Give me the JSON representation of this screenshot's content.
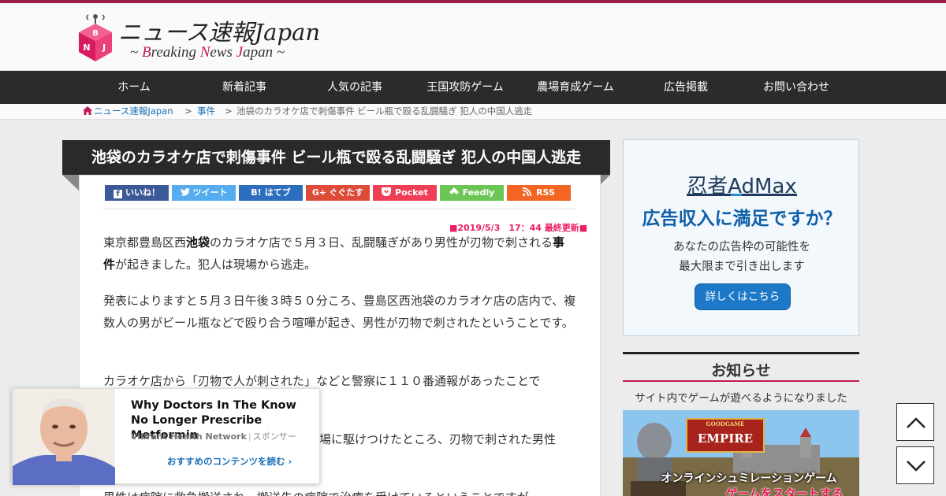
{
  "site": {
    "title": "ニュース速報Japan",
    "subtitle_parts": [
      "~ ",
      "B",
      "reaking ",
      "N",
      "ews ",
      "J",
      "apan ~"
    ],
    "logo_letters": [
      "B",
      "N",
      "J"
    ]
  },
  "nav": {
    "items": [
      "ホーム",
      "新着記事",
      "人気の記事",
      "王国攻防ゲーム",
      "農場育成ゲーム",
      "広告掲載",
      "お問い合わせ"
    ]
  },
  "breadcrumb": {
    "home": "ニュース速報Japan",
    "separator": ">",
    "category": "事件",
    "current": "池袋のカラオケ店で刺傷事件 ビール瓶で殴る乱闘騒ぎ 犯人の中国人逃走"
  },
  "article": {
    "title": "池袋のカラオケ店で刺傷事件 ビール瓶で殴る乱闘騒ぎ 犯人の中国人逃走",
    "updated": "■2019/5/3　17：44 最終更新■",
    "share": [
      {
        "label": "いいね！",
        "color": "#3b5998"
      },
      {
        "label": "ツイート",
        "color": "#55acee"
      },
      {
        "label": "はてブ",
        "color": "#2c6ebd"
      },
      {
        "label": "ぐぐたす",
        "color": "#dd4b39"
      },
      {
        "label": "Pocket",
        "color": "#ef3f56"
      },
      {
        "label": "Feedly",
        "color": "#6cc655"
      },
      {
        "label": "RSS",
        "color": "#f26522"
      }
    ],
    "p1": {
      "a": "東京都豊島区西",
      "b": "池袋",
      "c": "のカラオケ店で５月３日、乱闘騒ぎがあり男性が刃物で刺される",
      "d": "事件",
      "e": "が起きました。犯人は現場から逃走。"
    },
    "p2": "発表によりますと５月３日午後３時５０分ころ、豊島区西池袋のカラオケ店の店内で、複数人の男がビール瓶などで殴り合う喧嘩が起き、男性が刃物で刺されたということです。",
    "p3": "カラオケ店から「刃物で人が刺された」などと警察に１１０番通報があったことで",
    "p4": "場に駆けつけたところ、刃物で刺された男性",
    "p5": "男性は病院に救急搬送され、搬送先の病院で治療を受けているということですが"
  },
  "ad": {
    "brand": "忍者AdMax",
    "headline": "広告収入に満足ですか？",
    "line1": "あなたの広告枠の可能性を",
    "line2": "最大限まで引き出します",
    "button": "詳しくはこちら"
  },
  "notice": {
    "title": "お知らせ",
    "text": "サイト内でゲームが遊べるようになりました"
  },
  "game_banner": {
    "label": "オンラインシュミレーションゲーム",
    "cta": "ゲームをスタートする",
    "logo_small": "GOODGAME",
    "logo": "EMPIRE"
  },
  "popup": {
    "headline": "Why Doctors In The Know No Longer Prescribe Metformin",
    "source": "Vibrant Health Network",
    "sponsor": "スポンサー",
    "more": "おすすめのコンテンツを読む"
  },
  "colors": {
    "accent": "#c2185b",
    "nav_bg": "#2b2b2b",
    "link": "#1a6fb5"
  }
}
